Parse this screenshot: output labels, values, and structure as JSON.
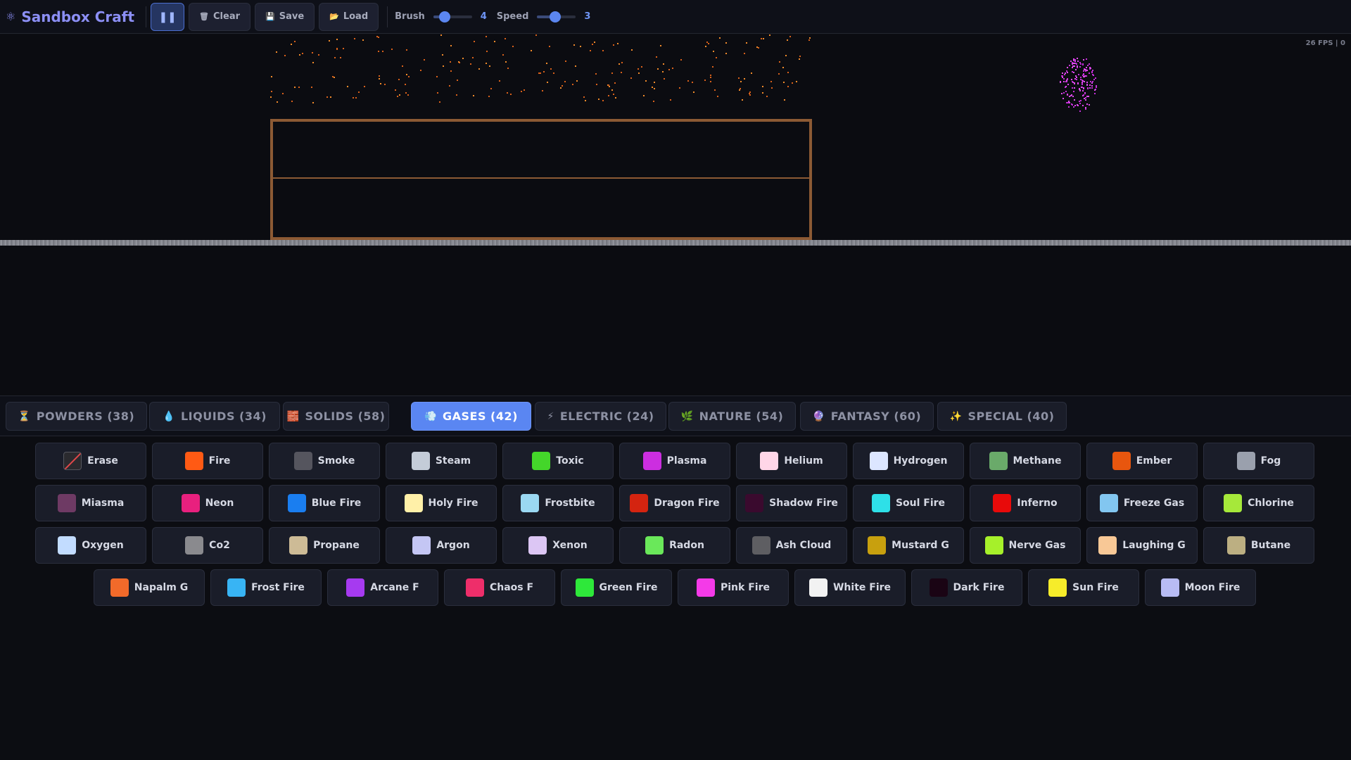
{
  "app": {
    "title": "Sandbox Craft",
    "logo_icon": "atom-icon"
  },
  "toolbar": {
    "pause_icon": "pause-icon",
    "clear_label": "Clear",
    "save_label": "Save",
    "load_label": "Load",
    "brush_label": "Brush",
    "brush_value": "4",
    "speed_label": "Speed",
    "speed_value": "3"
  },
  "status": {
    "fps_text": "26 FPS | 0"
  },
  "tabs": [
    {
      "icon": "⏳",
      "label": "POWDERS (38)",
      "active": false
    },
    {
      "icon": "💧",
      "label": "LIQUIDS (34)",
      "active": false
    },
    {
      "icon": "🧱",
      "label": "SOLIDS (58)",
      "active": false
    },
    {
      "icon": "💨",
      "label": "GASES (42)",
      "active": true
    },
    {
      "icon": "⚡",
      "label": "ELECTRIC (24)",
      "active": false
    },
    {
      "icon": "🌿",
      "label": "NATURE (54)",
      "active": false
    },
    {
      "icon": "🔮",
      "label": "FANTASY (60)",
      "active": false
    },
    {
      "icon": "✨",
      "label": "SPECIAL (40)",
      "active": false
    }
  ],
  "elements": [
    [
      {
        "label": "Erase",
        "color": "erase"
      },
      {
        "label": "Fire",
        "color": "#ff5a14"
      },
      {
        "label": "Smoke",
        "color": "#55555e"
      },
      {
        "label": "Steam",
        "color": "#c4ccd8"
      },
      {
        "label": "Toxic",
        "color": "#44d62a"
      },
      {
        "label": "Plasma",
        "color": "#cc2ee0"
      },
      {
        "label": "Helium",
        "color": "#ffd6e8"
      },
      {
        "label": "Hydrogen",
        "color": "#dce6ff"
      },
      {
        "label": "Methane",
        "color": "#6aaa6a"
      },
      {
        "label": "Ember",
        "color": "#e8560e"
      },
      {
        "label": "Fog",
        "color": "#9aa0ad"
      }
    ],
    [
      {
        "label": "Miasma",
        "color": "#6e3a64"
      },
      {
        "label": "Neon",
        "color": "#e8207e"
      },
      {
        "label": "Blue Fire",
        "color": "#1a7ef0"
      },
      {
        "label": "Holy Fire",
        "color": "#fff0a8"
      },
      {
        "label": "Frostbite",
        "color": "#9ad8f2"
      },
      {
        "label": "Dragon Fire",
        "color": "#d42410"
      },
      {
        "label": "Shadow Fire",
        "color": "#3a0a2e"
      },
      {
        "label": "Soul Fire",
        "color": "#2ee0e8"
      },
      {
        "label": "Inferno",
        "color": "#e80a0a"
      },
      {
        "label": "Freeze Gas",
        "color": "#82c6f0"
      },
      {
        "label": "Chlorine",
        "color": "#a6e83a"
      }
    ],
    [
      {
        "label": "Oxygen",
        "color": "#c2dcff"
      },
      {
        "label": "Co2",
        "color": "#8a8a8e"
      },
      {
        "label": "Propane",
        "color": "#cdbb96"
      },
      {
        "label": "Argon",
        "color": "#c4c6f4"
      },
      {
        "label": "Xenon",
        "color": "#dcc6f4"
      },
      {
        "label": "Radon",
        "color": "#6ae85a"
      },
      {
        "label": "Ash Cloud",
        "color": "#5e5e62"
      },
      {
        "label": "Mustard G",
        "color": "#c8a00e"
      },
      {
        "label": "Nerve Gas",
        "color": "#a6f02a"
      },
      {
        "label": "Laughing G",
        "color": "#f8c896"
      },
      {
        "label": "Butane",
        "color": "#bcaf82"
      }
    ],
    [
      {
        "label": "Napalm G",
        "color": "#f26a2a"
      },
      {
        "label": "Frost Fire",
        "color": "#38b4f4"
      },
      {
        "label": "Arcane F",
        "color": "#a63af0"
      },
      {
        "label": "Chaos F",
        "color": "#ee2e6a"
      },
      {
        "label": "Green Fire",
        "color": "#2ee83a"
      },
      {
        "label": "Pink Fire",
        "color": "#f43ae8"
      },
      {
        "label": "White Fire",
        "color": "#f2f2f2"
      },
      {
        "label": "Dark Fire",
        "color": "#1a0414"
      },
      {
        "label": "Sun Fire",
        "color": "#f6ec2a"
      },
      {
        "label": "Moon Fire",
        "color": "#b8bcf4"
      }
    ]
  ]
}
